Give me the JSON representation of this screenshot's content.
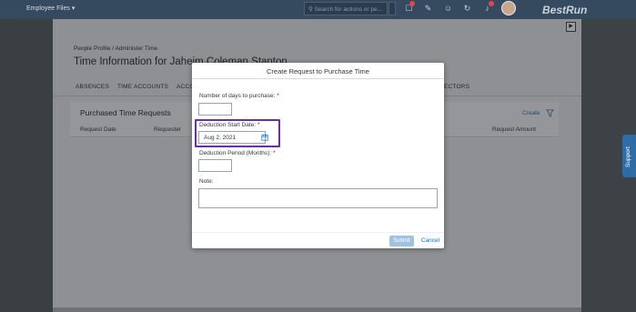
{
  "topbar": {
    "module_label": "Employee Files",
    "search_placeholder": "Search for actions or pe...",
    "logo": "BestRun"
  },
  "page": {
    "breadcrumb": "People Profile / Administer Time",
    "title": "Time Information for Jaheim Coleman Stanton",
    "tabs": [
      "ABSENCES",
      "TIME ACCOUNTS",
      "ACCO",
      "ECTORS"
    ],
    "section": {
      "title": "Purchased Time Requests",
      "create_label": "Create",
      "columns": [
        "Request Date",
        "Requester",
        "Request Amount"
      ]
    }
  },
  "support_label": "Support",
  "modal": {
    "title": "Create Request to Purchase Time",
    "fields": {
      "days_label": "Number of days to purchase:",
      "days_value": "",
      "start_label": "Deduction Start Date:",
      "start_value": "Aug 2, 2021",
      "period_label": "Deduction Period (Months):",
      "period_value": "",
      "note_label": "Note:",
      "note_value": ""
    },
    "required_mark": "*",
    "submit_label": "Submit",
    "cancel_label": "Cancel"
  },
  "colors": {
    "highlight": "#6b2fa5",
    "accent": "#0a6ed1",
    "required": "#bb0000"
  }
}
